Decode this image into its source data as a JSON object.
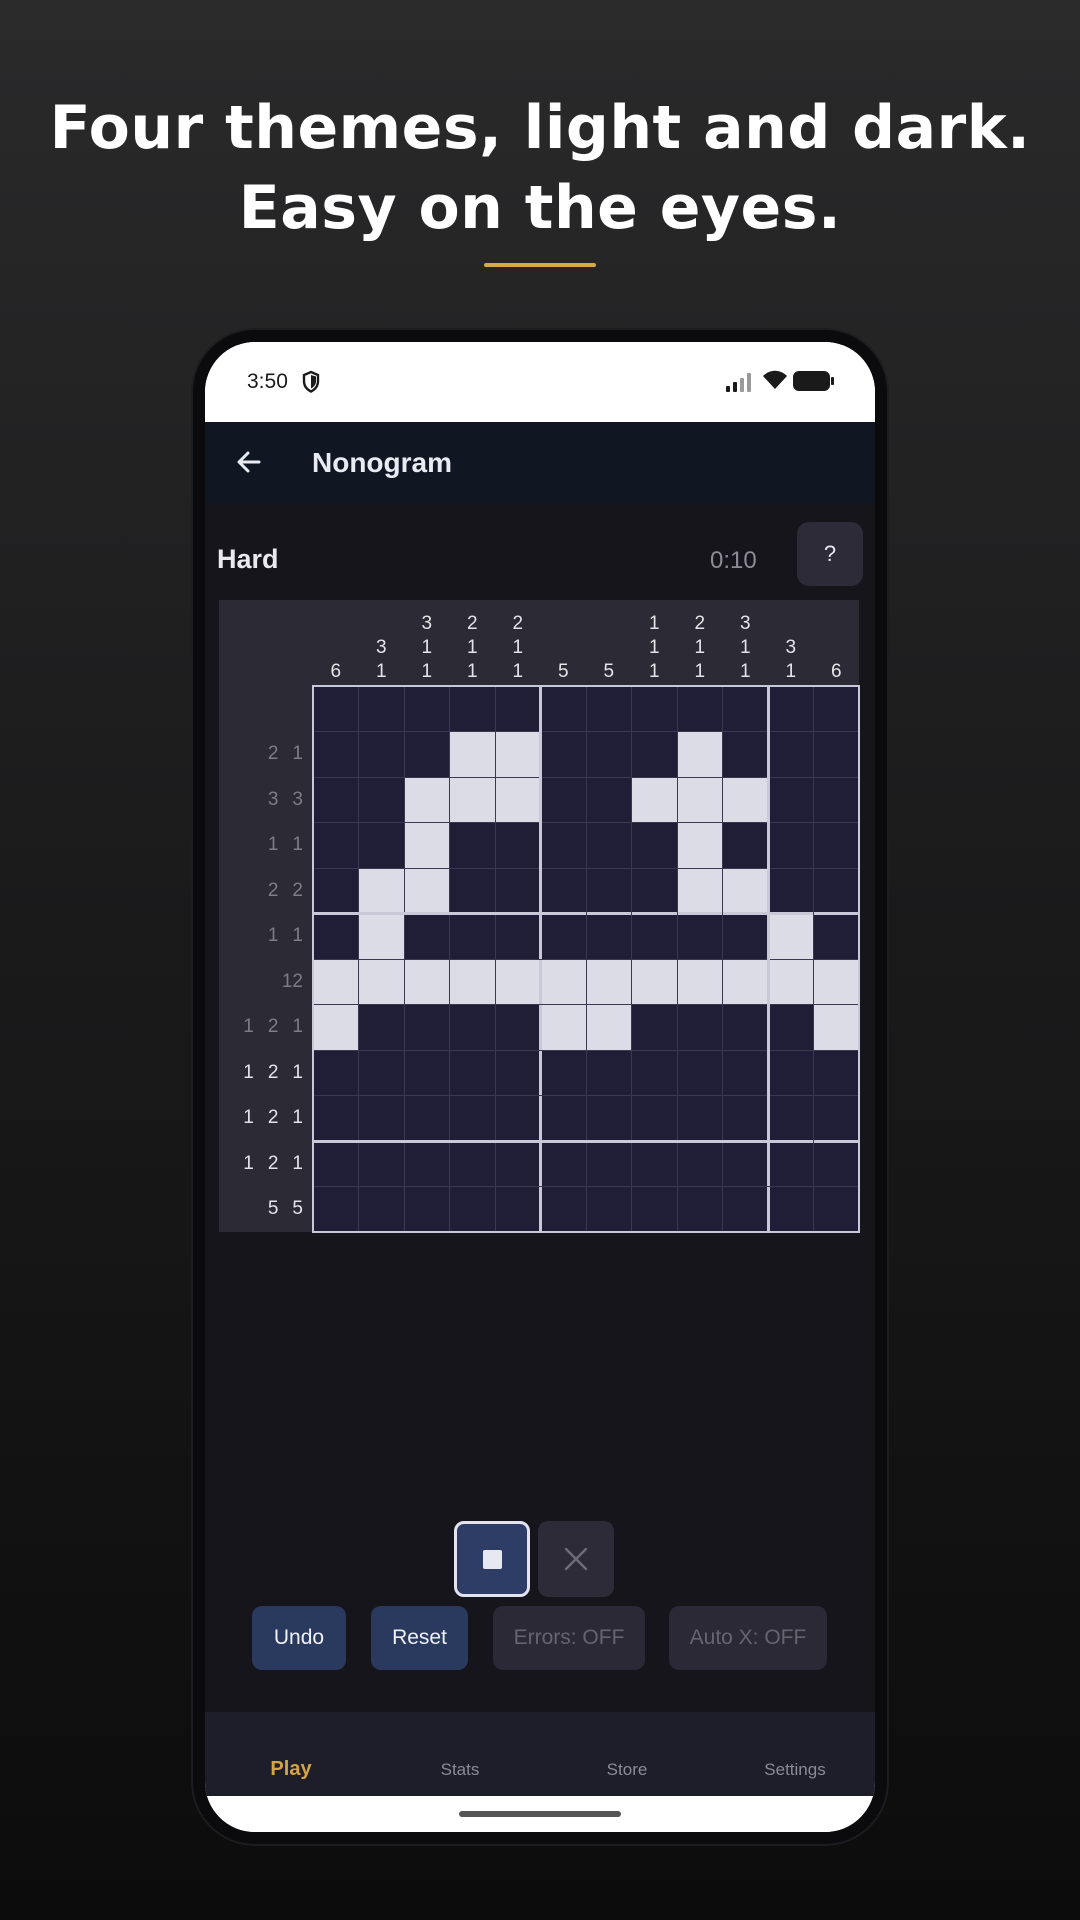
{
  "headline": {
    "line1": "Four themes, light and dark.",
    "line2": "Easy on the eyes."
  },
  "status_bar": {
    "time": "3:50",
    "icons": [
      "shield-icon",
      "signal-icon",
      "wifi-icon",
      "battery-icon"
    ]
  },
  "app_bar": {
    "back_icon": "arrow-left-icon",
    "title": "Nonogram"
  },
  "game": {
    "difficulty": "Hard",
    "timer": "0:10",
    "help_label": "?"
  },
  "puzzle": {
    "size": 12,
    "column_clues": [
      [
        "6"
      ],
      [
        "3",
        "1"
      ],
      [
        "3",
        "1",
        "1"
      ],
      [
        "2",
        "1",
        "1"
      ],
      [
        "2",
        "1",
        "1"
      ],
      [
        "5"
      ],
      [
        "5"
      ],
      [
        "1",
        "1",
        "1"
      ],
      [
        "2",
        "1",
        "1"
      ],
      [
        "3",
        "1",
        "1"
      ],
      [
        "3",
        "1"
      ],
      [
        "6"
      ]
    ],
    "column_clue_state": [
      "active",
      "active",
      "active",
      "active",
      "active",
      "active",
      "active",
      "active",
      "active",
      "active",
      "active",
      "active"
    ],
    "row_clues": [
      [],
      [
        "2",
        "1"
      ],
      [
        "3",
        "3"
      ],
      [
        "1",
        "1"
      ],
      [
        "2",
        "2"
      ],
      [
        "1",
        "1"
      ],
      [
        "12"
      ],
      [
        "1",
        "2",
        "1"
      ],
      [
        "1",
        "2",
        "1"
      ],
      [
        "1",
        "2",
        "1"
      ],
      [
        "1",
        "2",
        "1"
      ],
      [
        "5",
        "5"
      ]
    ],
    "row_clue_state": [
      "done",
      "done",
      "done",
      "done",
      "done",
      "done",
      "done",
      "done",
      "active",
      "active",
      "active",
      "active"
    ],
    "cells": [
      "000000000000",
      "000110001000",
      "001110011100",
      "001000001000",
      "011000001100",
      "010000000010",
      "111111111111",
      "100001100001",
      "000000000000",
      "000000000000",
      "000000000000",
      "000000000000"
    ]
  },
  "controls": {
    "mode_fill_icon": "filled-square-icon",
    "mode_x_icon": "x-mark-icon",
    "undo": "Undo",
    "reset": "Reset",
    "errors": "Errors: OFF",
    "auto_x": "Auto X: OFF"
  },
  "nav": {
    "items": [
      {
        "label": "Play",
        "active": true
      },
      {
        "label": "Stats",
        "active": false
      },
      {
        "label": "Store",
        "active": false
      },
      {
        "label": "Settings",
        "active": false
      }
    ]
  },
  "colors": {
    "accent_gold": "#d3a544",
    "filled_cell": "#dcdce6",
    "empty_cell": "#1f1e36",
    "primary_button": "#2a3a5f"
  }
}
